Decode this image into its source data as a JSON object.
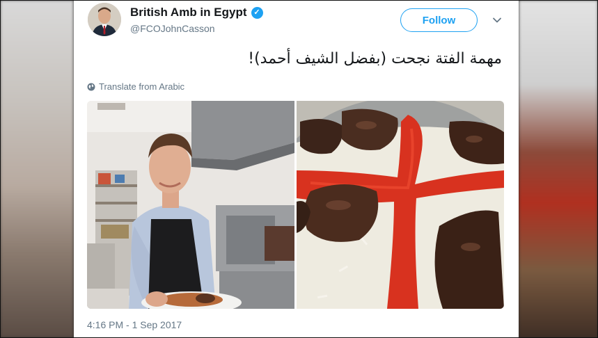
{
  "author": {
    "display_name": "British Amb in Egypt",
    "handle": "@FCOJohnCasson",
    "verified_icon": "verified-badge-icon"
  },
  "actions": {
    "follow_label": "Follow",
    "menu_icon": "chevron-down-icon"
  },
  "tweet": {
    "text": "مهمة الفتة نجحت (بفضل الشيف أحمد)!",
    "translate_label": "Translate from Arabic",
    "timestamp": "4:16 PM - 1 Sep 2017"
  },
  "media": {
    "count": 2,
    "photo_1": "man-in-kitchen-photo",
    "photo_2": "fatteh-dish-photo"
  },
  "colors": {
    "accent": "#1da1f2",
    "text_primary": "#14171a",
    "text_secondary": "#657786"
  }
}
